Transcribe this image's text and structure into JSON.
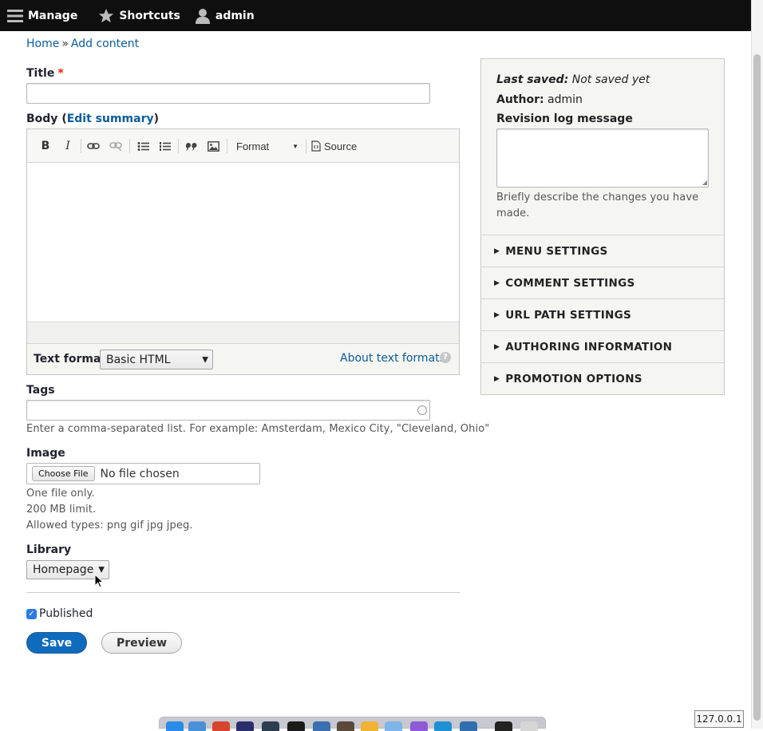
{
  "toolbar": {
    "manage": "Manage",
    "shortcuts": "Shortcuts",
    "user": "admin"
  },
  "breadcrumb": {
    "home": "Home",
    "separator": "»",
    "current": "Add content"
  },
  "form": {
    "title": {
      "label": "Title",
      "required_mark": "*",
      "value": ""
    },
    "body": {
      "label": "Body",
      "edit_summary_prefix": "(",
      "edit_summary_link": "Edit summary",
      "edit_summary_suffix": ")",
      "toolbar": {
        "bold": "B",
        "italic": "I",
        "format_label": "Format",
        "source_label": "Source"
      },
      "text_format_label": "Text format",
      "text_format_value": "Basic HTML",
      "about_text_formats": "About text formats"
    },
    "tags": {
      "label": "Tags",
      "value": "",
      "description": "Enter a comma-separated list. For example: Amsterdam, Mexico City, \"Cleveland, Ohio\""
    },
    "image": {
      "label": "Image",
      "choose_file": "Choose File",
      "no_file": "No file chosen",
      "help": [
        "One file only.",
        "200 MB limit.",
        "Allowed types: png gif jpg jpeg."
      ]
    },
    "library": {
      "label": "Library",
      "value": "Homepage"
    },
    "published": {
      "label": "Published",
      "checked": true
    },
    "actions": {
      "save": "Save",
      "preview": "Preview"
    }
  },
  "sidebar": {
    "last_saved_label": "Last saved:",
    "last_saved_value": "Not saved yet",
    "author_label": "Author:",
    "author_value": "admin",
    "revision_label": "Revision log message",
    "revision_value": "",
    "revision_help_line1": "Briefly describe the changes you have",
    "revision_help_line2": "made.",
    "details": [
      "MENU SETTINGS",
      "COMMENT SETTINGS",
      "URL PATH SETTINGS",
      "AUTHORING INFORMATION",
      "PROMOTION OPTIONS"
    ]
  },
  "status": {
    "host": "127.0.0.1"
  },
  "colors": {
    "toolbar_bg": "#0f0f0f",
    "link": "#0a5c99",
    "primary_button": "#0f6bbd",
    "required": "#e62600"
  }
}
